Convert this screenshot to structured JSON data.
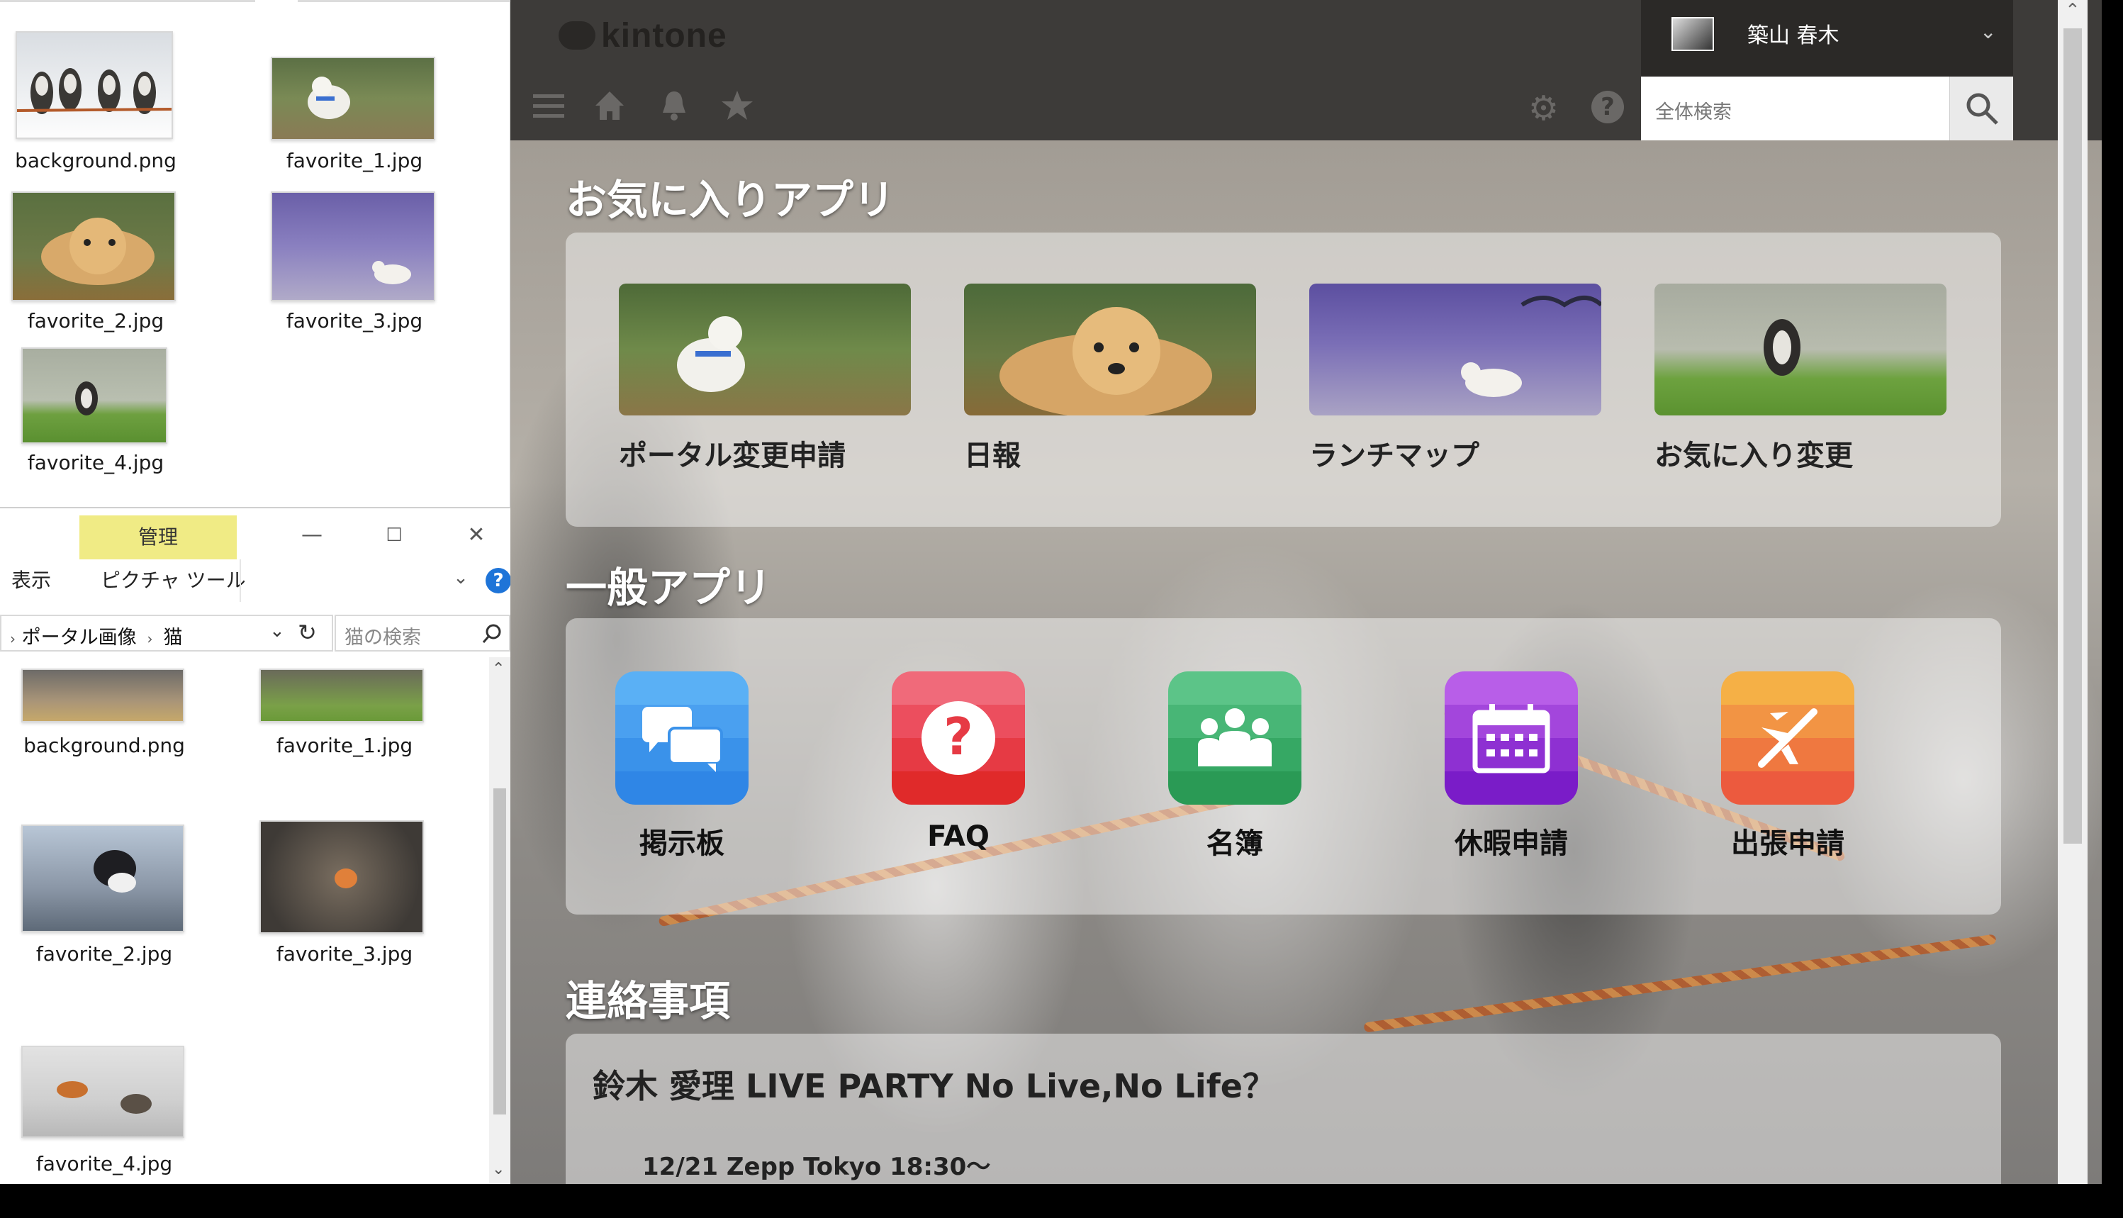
{
  "explorer_top": {
    "files": [
      {
        "name": "background.png"
      },
      {
        "name": "favorite_1.jpg"
      },
      {
        "name": "favorite_2.jpg"
      },
      {
        "name": "favorite_3.jpg"
      },
      {
        "name": "favorite_4.jpg"
      }
    ]
  },
  "explorer_bottom": {
    "ribbon_context": "管理",
    "tab_view": "表示",
    "tab_picture_tools": "ピクチャ ツール",
    "help_label": "?",
    "breadcrumb": [
      "ポータル画像",
      "猫"
    ],
    "search_placeholder": "猫の検索",
    "files": [
      {
        "name": "background.png"
      },
      {
        "name": "favorite_1.jpg"
      },
      {
        "name": "favorite_2.jpg"
      },
      {
        "name": "favorite_3.jpg"
      },
      {
        "name": "favorite_4.jpg"
      }
    ]
  },
  "kintone": {
    "logo_text": "kintone",
    "user_name": "築山 春木",
    "search_placeholder": "全体検索",
    "favorites_title": "お気に入りアプリ",
    "favorites": [
      {
        "label": "ポータル変更申請"
      },
      {
        "label": "日報"
      },
      {
        "label": "ランチマップ"
      },
      {
        "label": "お気に入り変更"
      }
    ],
    "general_title": "一般アプリ",
    "apps": [
      {
        "label": "掲示板",
        "icon": "chat-icon",
        "color_top": "#5ab0f5",
        "color_bottom": "#2f86e6"
      },
      {
        "label": "FAQ",
        "icon": "question-icon",
        "color_top": "#f06a7a",
        "color_bottom": "#e02a2a"
      },
      {
        "label": "名簿",
        "icon": "people-icon",
        "color_top": "#5cc488",
        "color_bottom": "#2a9a55"
      },
      {
        "label": "休暇申請",
        "icon": "calendar-icon",
        "color_top": "#b85ee8",
        "color_bottom": "#7a1cc8"
      },
      {
        "label": "出張申請",
        "icon": "plane-icon",
        "color_top": "#f5b046",
        "color_bottom": "#ec5a3e"
      }
    ],
    "notice_title": "連絡事項",
    "notice_heading": "鈴木 愛理 LIVE PARTY No Live,No Life？",
    "notice_body": "12/21 Zepp Tokyo 18:30〜"
  }
}
